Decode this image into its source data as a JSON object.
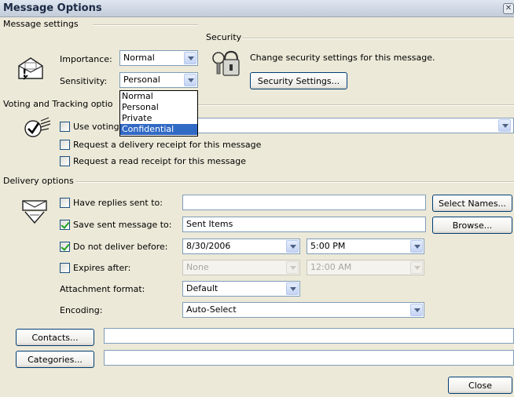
{
  "window": {
    "title": "Message Options"
  },
  "message_settings": {
    "heading": "Message settings",
    "importance_label": "Importance:",
    "importance_value": "Normal",
    "sensitivity_label": "Sensitivity:",
    "sensitivity_value": "Personal",
    "sensitivity_options": [
      "Normal",
      "Personal",
      "Private",
      "Confidential"
    ],
    "highlighted_option": "Confidential"
  },
  "security": {
    "heading": "Security",
    "description": "Change security settings for this message.",
    "button_label": "Security Settings..."
  },
  "voting": {
    "heading": "Voting and Tracking optio",
    "use_voting_label": "Use voting",
    "use_voting_checked": false,
    "delivery_receipt_label": "Request a delivery receipt for this message",
    "delivery_receipt_checked": false,
    "read_receipt_label": "Request a read receipt for this message",
    "read_receipt_checked": false
  },
  "delivery": {
    "heading": "Delivery options",
    "have_replies_label": "Have replies sent to:",
    "have_replies_checked": false,
    "have_replies_value": "",
    "select_names_label": "Select Names...",
    "save_sent_label": "Save sent message to:",
    "save_sent_checked": true,
    "save_sent_value": "Sent Items",
    "browse_label": "Browse...",
    "do_not_deliver_label": "Do not deliver before:",
    "do_not_deliver_checked": true,
    "do_not_deliver_date": "8/30/2006",
    "do_not_deliver_time": "5:00 PM",
    "expires_label": "Expires after:",
    "expires_checked": false,
    "expires_date": "None",
    "expires_time": "12:00 AM",
    "attachment_format_label": "Attachment format:",
    "attachment_format_value": "Default",
    "encoding_label": "Encoding:",
    "encoding_value": "Auto-Select"
  },
  "contacts": {
    "button_label": "Contacts...",
    "value": ""
  },
  "categories": {
    "button_label": "Categories...",
    "value": ""
  },
  "footer": {
    "close_label": "Close"
  },
  "colors": {
    "accent": "#316ac5",
    "dialog_bg": "#ece9d8",
    "input_border": "#7f9db9"
  }
}
